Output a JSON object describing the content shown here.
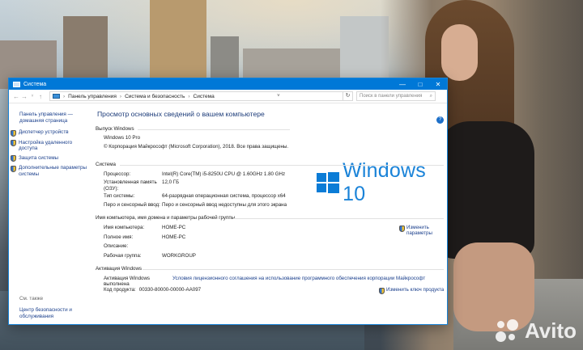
{
  "window": {
    "title": "Система",
    "controls": {
      "minimize": "—",
      "maximize": "□",
      "close": "✕"
    }
  },
  "address_bar": {
    "back": "←",
    "forward": "→",
    "up": "↑",
    "crumbs": [
      "Панель управления",
      "Система и безопасность",
      "Система"
    ],
    "search_placeholder": "Поиск в панели управления"
  },
  "sidebar": {
    "home_line1": "Панель управления —",
    "home_line2": "домашняя страница",
    "items": [
      {
        "label": "Диспетчер устройств"
      },
      {
        "label": "Настройка удаленного доступа"
      },
      {
        "label": "Защита системы"
      },
      {
        "label": "Дополнительные параметры системы"
      }
    ],
    "see_also": "См. также",
    "bottom_link": "Центр безопасности и обслуживания"
  },
  "main": {
    "heading": "Просмотр основных сведений о вашем компьютере",
    "edition_section": {
      "title": "Выпуск Windows",
      "edition": "Windows 10 Pro",
      "copyright": "© Корпорация Майкрософт (Microsoft Corporation), 2018. Все права защищены."
    },
    "logo_text": "Windows 10",
    "system_section": {
      "title": "Система",
      "rows": [
        {
          "k": "Процессор:",
          "v": "Intel(R) Core(TM) i5-8250U CPU @ 1.60GHz   1.80 GHz"
        },
        {
          "k": "Установленная память (ОЗУ):",
          "v": "12,0 ГБ"
        },
        {
          "k": "Тип системы:",
          "v": "64-разрядная операционная система, процессор x64"
        },
        {
          "k": "Перо и сенсорный ввод:",
          "v": "Перо и сенсорный ввод недоступны для этого экрана"
        }
      ]
    },
    "name_section": {
      "title": "Имя компьютера, имя домена и параметры рабочей группы",
      "rows": [
        {
          "k": "Имя компьютера:",
          "v": "HOME-PC"
        },
        {
          "k": "Полное имя:",
          "v": "HOME-PC"
        },
        {
          "k": "Описание:",
          "v": ""
        },
        {
          "k": "Рабочая группа:",
          "v": "WORKGROUP"
        }
      ],
      "change_link_line1": "Изменить",
      "change_link_line2": "параметры"
    },
    "activation_section": {
      "title": "Активация Windows",
      "status": "Активация Windows выполнена",
      "license_link": "Условия лицензионного соглашения на использование программного обеспечения корпорации Майкрософт",
      "product_id_label": "Код продукта:",
      "product_id": "00330-80000-00000-AA097",
      "change_key_link": "Изменить ключ продукта"
    }
  },
  "watermark": "Avito",
  "colors": {
    "titlebar": "#0078d7",
    "link": "#1a3f8c",
    "heading": "#1e3d7a",
    "logo": "#1a83d8"
  }
}
